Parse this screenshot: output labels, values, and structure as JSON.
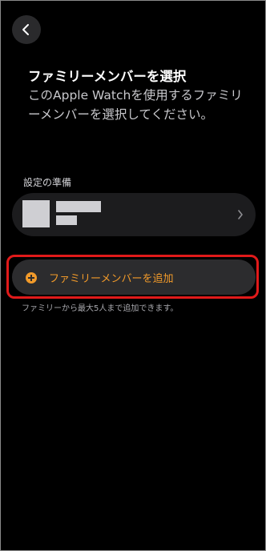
{
  "header": {
    "back_icon": "chevron-left-icon",
    "title": "ファミリーメンバーを選択",
    "subtitle": "このApple Watchを使用するファミリーメンバーを選択してください。"
  },
  "setup": {
    "section_label": "設定の準備",
    "member_chevron_icon": "chevron-right-icon"
  },
  "add_member": {
    "icon": "plus-circle-icon",
    "accent_color": "#f19a2a",
    "label": "ファミリーメンバーを追加"
  },
  "footer_note": "ファミリーから最大5人まで追加できます。",
  "colors": {
    "background": "#000000",
    "card": "#1c1c1e",
    "highlight": "#e11a1a"
  }
}
